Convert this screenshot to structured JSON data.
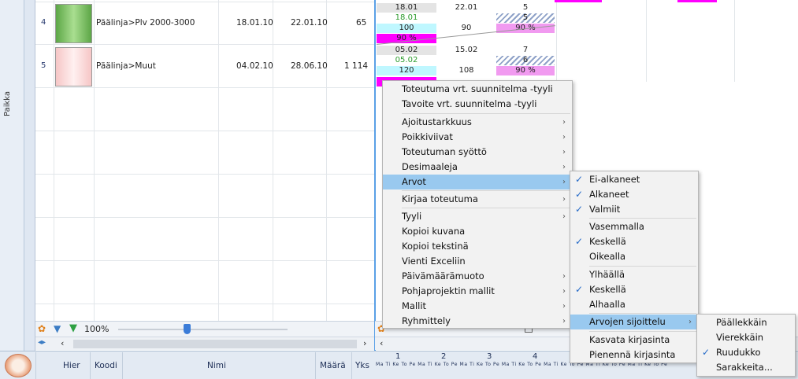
{
  "side_label": "Paikka",
  "rows": [
    {
      "num": "4",
      "name": "Päälinja>Plv 2000-3000",
      "start": "18.01.10",
      "end": "22.01.10",
      "qty": "65",
      "color": "#7fc26a",
      "g_top": "18.01",
      "g_top2": "22.01",
      "g_top3": "5",
      "g_mid": "18.01",
      "g_mid3": "5",
      "g_val1": "100",
      "g_val2": "90",
      "g_pct": "90 %",
      "g_bot": "90 %"
    },
    {
      "num": "5",
      "name": "Päälinja>Muut",
      "start": "04.02.10",
      "end": "28.06.10",
      "qty": "1 114",
      "color": "#ffe0e0",
      "g_top": "05.02",
      "g_top2": "15.02",
      "g_top3": "7",
      "g_mid": "05.02",
      "g_mid3": "6",
      "g_val1": "120",
      "g_val2": "108",
      "g_pct": "90 %",
      "g_bot": ""
    }
  ],
  "zoom": "100%",
  "header": {
    "hier": "Hier",
    "koodi": "Koodi",
    "nimi": "Nimi",
    "maara": "Määrä",
    "yks": "Yks"
  },
  "weeks": [
    "1",
    "2",
    "3",
    "4"
  ],
  "days": "Ma Ti Ke To Pe Ma Ti Ke To Pe Ma Ti Ke To Pe Ma Ti Ke To Pe Ma Ti Ke To Pe Ma Ti Ke To Pe Ma Ti Ke To Pe",
  "menu_main": [
    "Toteutuma vrt. suunnitelma -tyyli",
    "Tavoite vrt. suunnitelma -tyyli",
    "Ajoitustarkkuus",
    "Poikkiviivat",
    "Toteutuman syöttö",
    "Desimaaleja",
    "Arvot",
    "Kirjaa toteutuma",
    "Tyyli",
    "Kopioi kuvana",
    "Kopioi tekstinä",
    "Vienti Exceliin",
    "Päivämäärämuoto",
    "Pohjaprojektin mallit",
    "Mallit",
    "Ryhmittely"
  ],
  "menu_arvot": [
    "Ei-alkaneet",
    "Alkaneet",
    "Valmiit",
    "Vasemmalla",
    "Keskellä",
    "Oikealla",
    "Ylhäällä",
    "Keskellä",
    "Alhaalla",
    "Arvojen sijoittelu",
    "Kasvata kirjasinta",
    "Pienennä kirjasinta"
  ],
  "menu_sijoittelu": [
    "Päällekkäin",
    "Vierekkäin",
    "Ruudukko",
    "Sarakkeita..."
  ],
  "colors": {
    "accent": "#99c9ef",
    "check": "#2369c8",
    "magenta": "#ff00ff",
    "cyan": "#bff7ff"
  }
}
